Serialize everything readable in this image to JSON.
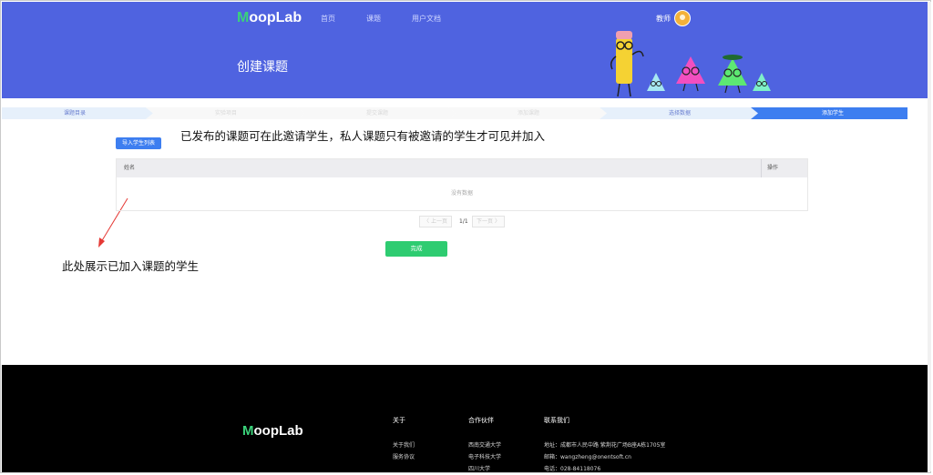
{
  "header": {
    "logo_first": "M",
    "logo_rest": "oopLab",
    "nav": [
      "首页",
      "课题",
      "用户文档"
    ],
    "user_label": "教师",
    "page_title": "创建课题"
  },
  "steps": [
    "课题目录",
    "实验项目",
    "提交课题",
    "添加课题",
    "选择数据",
    "添加学生"
  ],
  "annotations": {
    "top": "已发布的课题可在此邀请学生，私人课题只有被邀请的学生才可见并加入",
    "left": "此处展示已加入课题的学生"
  },
  "actions": {
    "import_label": "导入学生列表",
    "done_label": "完成"
  },
  "table": {
    "columns": [
      "姓名",
      "操作"
    ],
    "empty_text": "没有数据"
  },
  "pagination": {
    "prev": "〈 上一页",
    "page": "1/1",
    "next": "下一页 〉"
  },
  "footer": {
    "logo_first": "M",
    "logo_rest": "oopLab",
    "about": {
      "title": "关于",
      "items": [
        "关于我们",
        "服务协议"
      ]
    },
    "partners": {
      "title": "合作伙伴",
      "items": [
        "西南交通大学",
        "电子科技大学",
        "四川大学"
      ]
    },
    "contact": {
      "title": "联系我们",
      "items": [
        "地址：成都市人民中路 紫荆花广场B座A栋1705室",
        "邮箱：wangzheng@onentsoft.cn",
        "电话：028-84118076"
      ]
    }
  },
  "colors": {
    "header_bg": "#4f63e0",
    "primary_button": "#3d7ef0",
    "done_button": "#2ecc71",
    "active_step": "#3d7ef0",
    "arrow": "#e53935"
  }
}
